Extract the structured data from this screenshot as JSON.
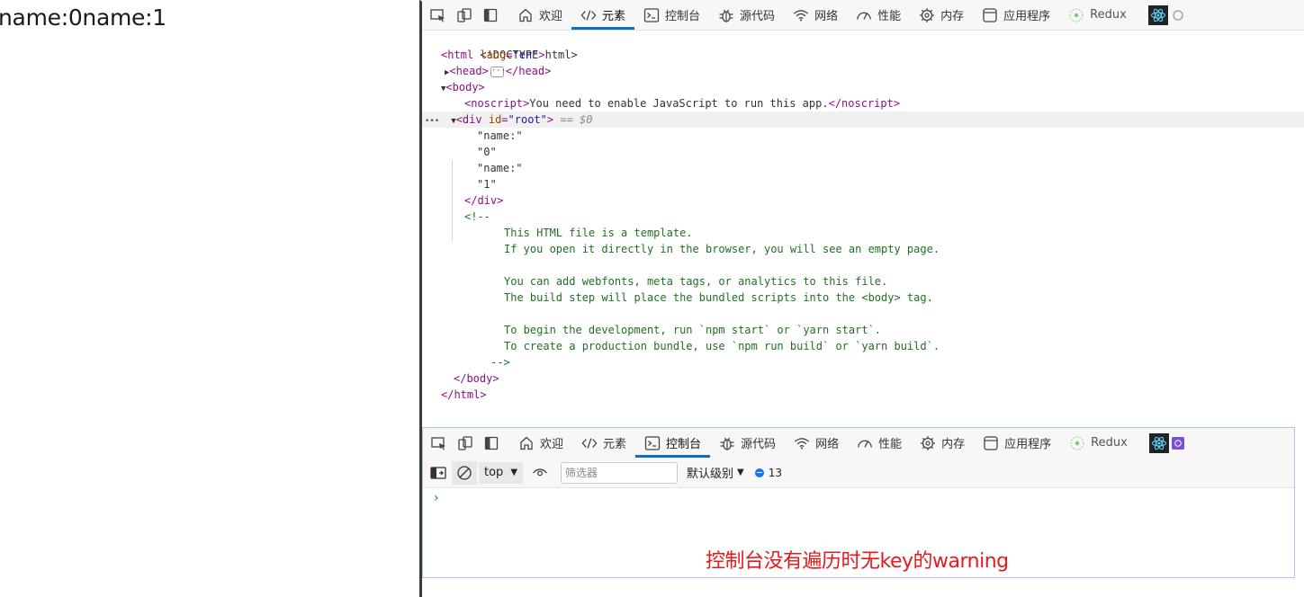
{
  "page": {
    "text": "name:0name:1"
  },
  "devtools": {
    "tabs": [
      {
        "label": "欢迎",
        "icon": "home-icon"
      },
      {
        "label": "元素",
        "icon": "code-icon"
      },
      {
        "label": "控制台",
        "icon": "console-icon"
      },
      {
        "label": "源代码",
        "icon": "bug-icon"
      },
      {
        "label": "网络",
        "icon": "wifi-icon"
      },
      {
        "label": "性能",
        "icon": "gauge-icon"
      },
      {
        "label": "内存",
        "icon": "memory-chip-icon"
      },
      {
        "label": "应用程序",
        "icon": "application-icon"
      },
      {
        "label": "Redux",
        "icon": "redux-icon"
      }
    ],
    "top_active_tab": "元素",
    "drawer_active_tab": "控制台",
    "accent": "#0f6cbd",
    "elements": {
      "doctype": "<!DOCTYPE html>",
      "html_open_tag": "html",
      "html_attr_name": "lang",
      "html_attr_value": "\"en\"",
      "head_open": "<head>",
      "head_close": "</head>",
      "body_open": "<body>",
      "noscript_open": "<noscript>",
      "noscript_text": "You need to enable JavaScript to run this app.",
      "noscript_close": "</noscript>",
      "div_tag": "div",
      "div_attr_name": "id",
      "div_attr_value": "\"root\"",
      "div_ref": "== $0",
      "text_nodes": [
        "\"name:\"",
        "\"0\"",
        "\"name:\"",
        "\"1\""
      ],
      "div_close": "</div>",
      "comment_open": "<!--",
      "comment_lines": [
        "This HTML file is a template.",
        "If you open it directly in the browser, you will see an empty page.",
        "",
        "You can add webfonts, meta tags, or analytics to this file.",
        "The build step will place the bundled scripts into the <body> tag.",
        "",
        "To begin the development, run `npm start` or `yarn start`.",
        "To create a production bundle, use `npm run build` or `yarn build`."
      ],
      "comment_close": "-->",
      "body_close": "</body>",
      "html_close": "</html>"
    },
    "console": {
      "context": "top",
      "filter_placeholder": "筛选器",
      "levels": "默认级别",
      "message_count": "13",
      "prompt": "›"
    }
  },
  "annotation": "控制台没有遍历时无key的warning"
}
